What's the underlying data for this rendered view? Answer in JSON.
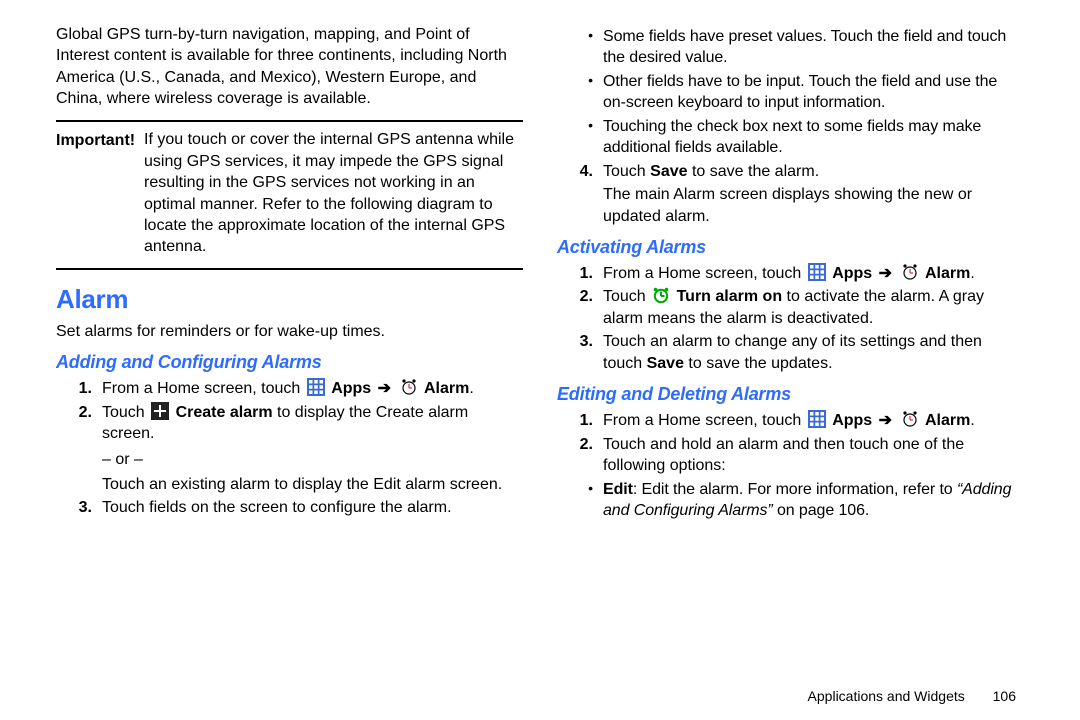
{
  "left": {
    "intro": "Global GPS turn-by-turn navigation, mapping, and Point of Interest content is available for three continents, including North America (U.S., Canada, and Mexico), Western Europe, and China, where wireless coverage is available.",
    "important_label": "Important!",
    "important_body": "If you touch or cover the internal GPS antenna while using GPS services, it may impede the GPS signal resulting in the GPS services not working in an optimal manner. Refer to the following diagram to locate the approximate location of the internal GPS antenna.",
    "h1_alarm": "Alarm",
    "alarm_desc": "Set alarms for reminders or for wake-up times.",
    "h2_addconfig": "Adding and Configuring Alarms",
    "s1_pre": "From a Home screen, touch ",
    "apps_label": "Apps",
    "alarm_label": "Alarm",
    "period": ".",
    "s2_pre": "Touch ",
    "s2_b": "Create alarm",
    "s2_post": " to display the Create alarm screen.",
    "or": "– or –",
    "s2_alt": "Touch an existing alarm to display the Edit alarm screen.",
    "s3": "Touch fields on the screen to configure the alarm."
  },
  "right": {
    "b1": "Some fields have preset values. Touch the field and touch the desired value.",
    "b2": "Other fields have to be input. Touch the field and use the on-screen keyboard to input information.",
    "b3": "Touching the check box next to some fields may make additional fields available.",
    "s4_pre": "Touch ",
    "s4_b": "Save",
    "s4_post": " to save the alarm.",
    "s4_note": "The main Alarm screen displays showing the new or updated alarm.",
    "h2_activate": "Activating Alarms",
    "a1_pre": "From a Home screen, touch ",
    "apps_label": "Apps",
    "alarm_label": "Alarm",
    "period": ".",
    "a2_pre": "Touch ",
    "a2_b": "Turn alarm on",
    "a2_post": " to activate the alarm. A gray alarm means the alarm is deactivated.",
    "a3_pre": "Touch an alarm to change any of its settings and then touch ",
    "a3_b": "Save",
    "a3_post": " to save the updates.",
    "h2_edit": "Editing and Deleting Alarms",
    "e1_pre": "From a Home screen, touch ",
    "e2": "Touch and hold an alarm and then touch one of the following options:",
    "e2b_pre": "Edit",
    "e2b_mid": ": Edit the alarm. For more information, refer to ",
    "e2b_ital": "“Adding and Configuring Alarms”",
    "e2b_post": " on page 106."
  },
  "footer": {
    "section": "Applications and Widgets",
    "page": "106"
  }
}
